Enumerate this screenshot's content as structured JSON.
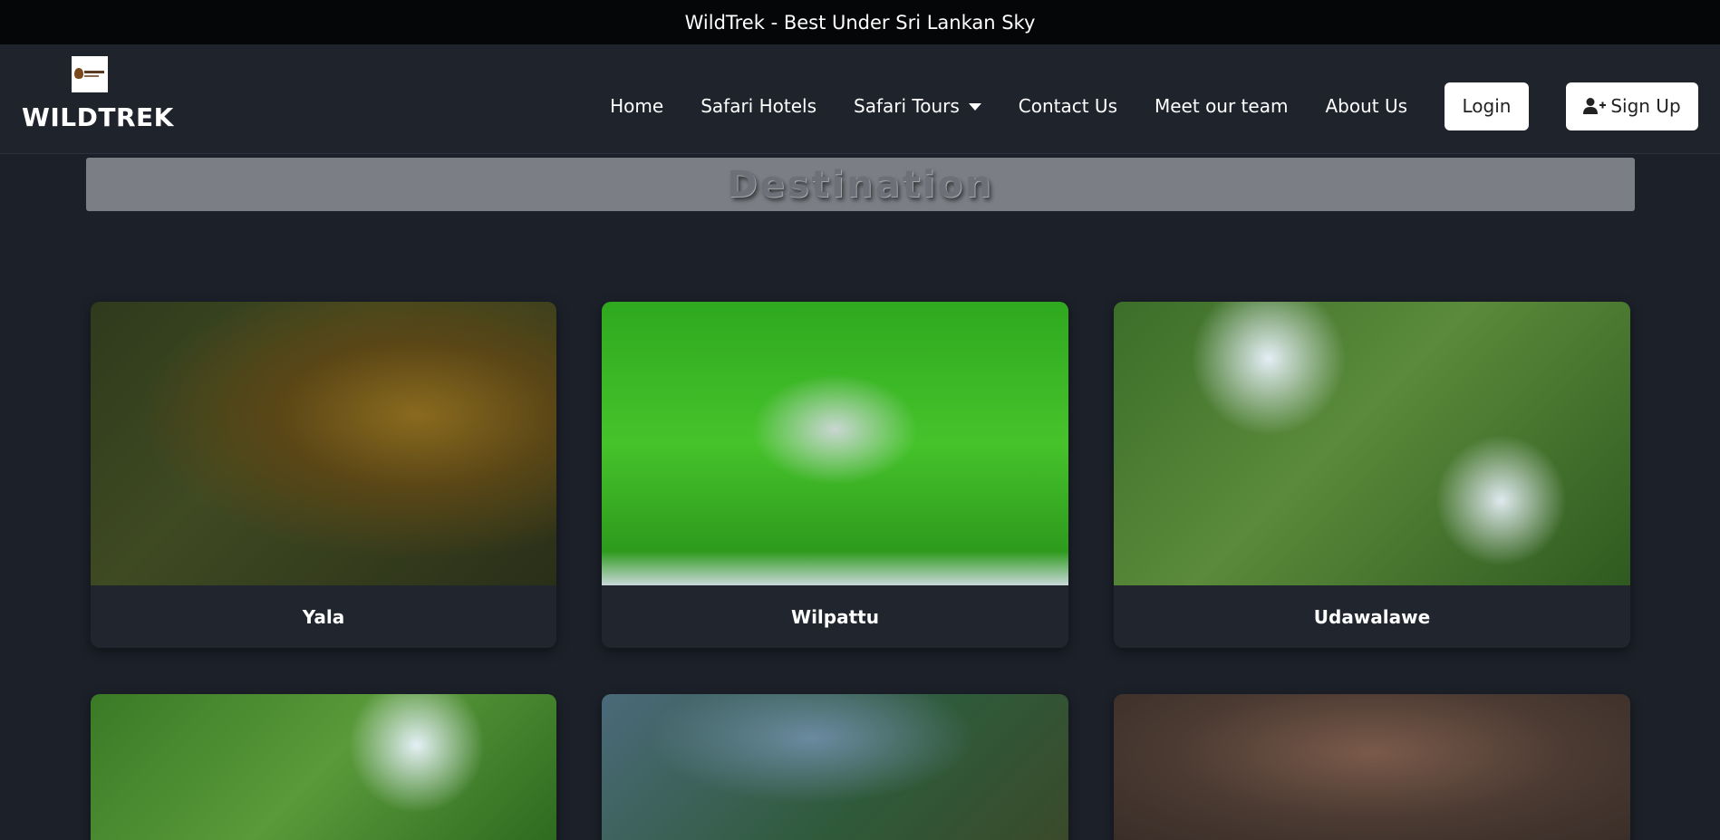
{
  "topbar": {
    "text": "WildTrek - Best Under Sri Lankan Sky"
  },
  "brand": {
    "name": "WILDTREK",
    "logo_icon": "wildtrek-logo"
  },
  "nav": {
    "items": [
      {
        "label": "Home"
      },
      {
        "label": "Safari Hotels"
      },
      {
        "label": "Safari Tours",
        "dropdown": true
      },
      {
        "label": "Contact Us"
      },
      {
        "label": "Meet our team"
      },
      {
        "label": "About Us"
      }
    ],
    "login_label": "Login",
    "signup_label": "Sign Up",
    "signup_icon": "user-plus-icon"
  },
  "section": {
    "heading": "Destination"
  },
  "destinations": [
    {
      "name": "Yala",
      "image": "leopard-photo"
    },
    {
      "name": "Wilpattu",
      "image": "elephant-photo"
    },
    {
      "name": "Udawalawe",
      "image": "eagle-photo"
    },
    {
      "name": "",
      "image": "blue-magpie-photo"
    },
    {
      "name": "",
      "image": "ground-thrush-photo"
    },
    {
      "name": "",
      "image": "macaque-photo"
    }
  ],
  "colors": {
    "page_bg": "#1c2029",
    "topbar_bg": "#050607",
    "navbar_bg": "#1f232c",
    "banner_bg": "#7b7f85",
    "card_bg": "#20252e"
  }
}
